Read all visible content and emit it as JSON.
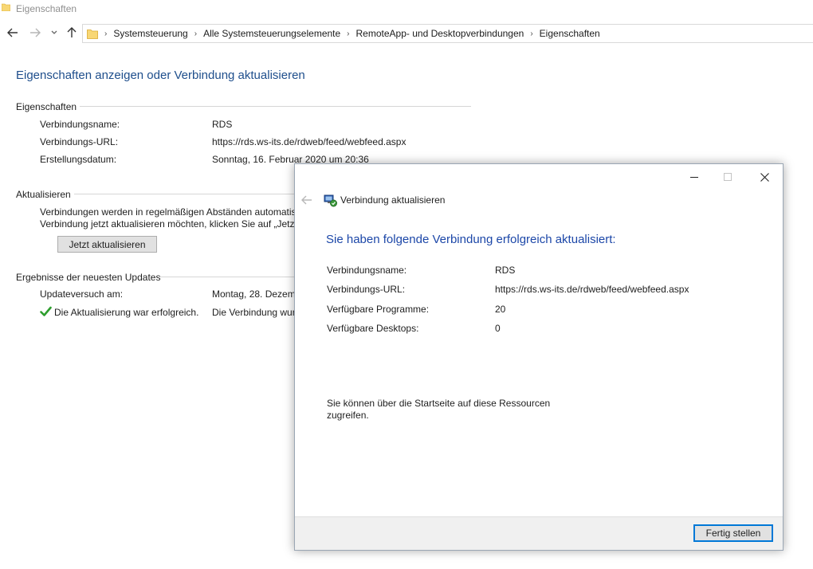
{
  "window": {
    "title": "Eigenschaften"
  },
  "navigation": {
    "back_icon": "arrow-left-icon",
    "forward_icon": "arrow-right-icon",
    "recent_icon": "chevron-down-icon",
    "up_icon": "arrow-up-icon",
    "breadcrumbs": [
      "Systemsteuerung",
      "Alle Systemsteuerungselemente",
      "RemoteApp- und Desktopverbindungen",
      "Eigenschaften"
    ]
  },
  "main": {
    "heading": "Eigenschaften anzeigen oder Verbindung aktualisieren",
    "properties": {
      "label": "Eigenschaften",
      "rows": [
        {
          "label": "Verbindungsname:",
          "value": "RDS"
        },
        {
          "label": "Verbindungs-URL:",
          "value": "https://rds.ws-its.de/rdweb/feed/webfeed.aspx"
        },
        {
          "label": "Erstellungsdatum:",
          "value": "Sonntag, 16. Februar 2020 um 20:36"
        }
      ]
    },
    "update": {
      "label": "Aktualisieren",
      "text_line1": "Verbindungen werden in regelmäßigen Abständen automatis",
      "text_line2": "Verbindung jetzt aktualisieren möchten, klicken Sie auf „Jetzt",
      "button": "Jetzt aktualisieren"
    },
    "results": {
      "label": "Ergebnisse der neuesten Updates",
      "attempt_label": "Updateversuch am:",
      "attempt_value": "Montag, 28. Dezem",
      "status_label": "Die Aktualisierung war erfolgreich.",
      "status_value": "Die Verbindung wur",
      "status_color": "#2e9e2e"
    }
  },
  "dialog": {
    "title": "Verbindung aktualisieren",
    "heading": "Sie haben folgende Verbindung erfolgreich aktualisiert:",
    "rows": [
      {
        "label": "Verbindungsname:",
        "value": "RDS"
      },
      {
        "label": "Verbindungs-URL:",
        "value": "https://rds.ws-its.de/rdweb/feed/webfeed.aspx"
      },
      {
        "label": "Verfügbare Programme:",
        "value": "20"
      },
      {
        "label": "Verfügbare Desktops:",
        "value": "0"
      }
    ],
    "info_line1": "Sie können über die Startseite auf diese Ressourcen",
    "info_line2": "zugreifen.",
    "finish_button": "Fertig stellen"
  },
  "colors": {
    "heading_blue": "#1e4e8c",
    "dialog_heading_blue": "#1c47a8",
    "accent_focus": "#0078d7"
  }
}
